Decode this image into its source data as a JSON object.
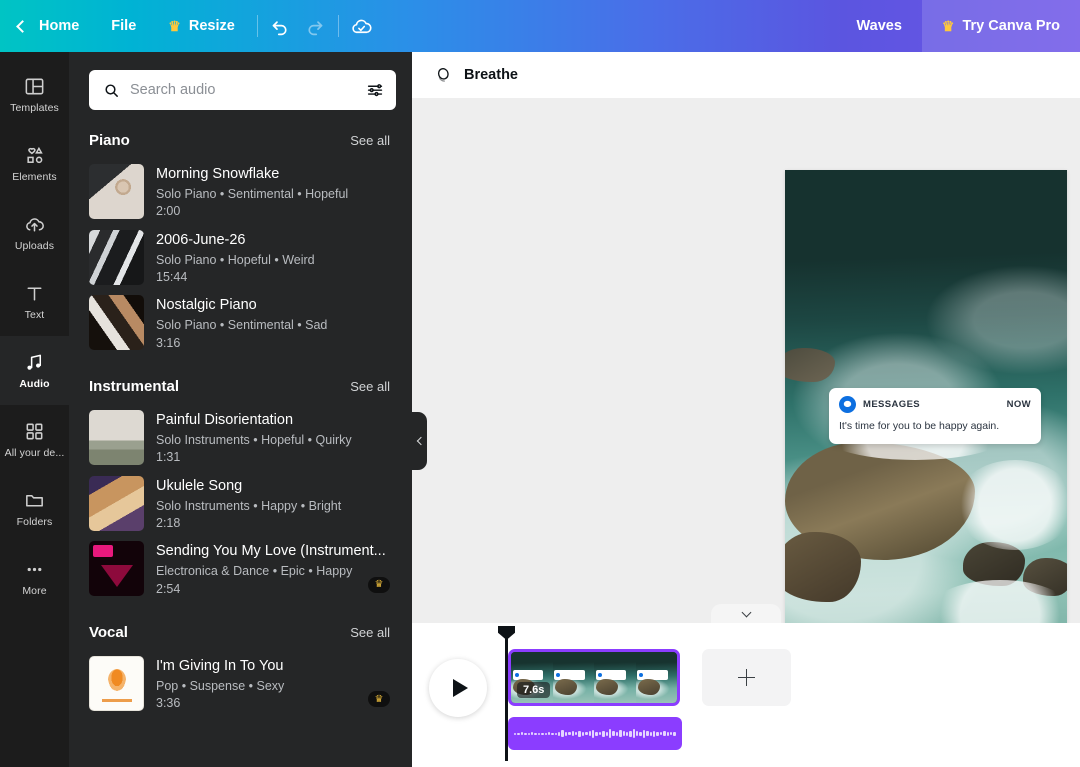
{
  "topbar": {
    "back_icon": "chevron-left-icon",
    "home_label": "Home",
    "file_label": "File",
    "resize_label": "Resize",
    "resize_crown": "♛",
    "undo_icon": "undo-icon",
    "redo_icon": "redo-icon",
    "cloud_icon": "cloud-saved-icon",
    "waves_label": "Waves",
    "try_pro_label": "Try Canva Pro",
    "try_pro_crown": "♛",
    "gradient_start": "#00c4c4",
    "gradient_end": "#6f55e8"
  },
  "rail": {
    "items": [
      {
        "label": "Templates",
        "icon": "templates-icon",
        "active": false
      },
      {
        "label": "Elements",
        "icon": "elements-icon",
        "active": false
      },
      {
        "label": "Uploads",
        "icon": "uploads-icon",
        "active": false
      },
      {
        "label": "Text",
        "icon": "text-icon",
        "active": false
      },
      {
        "label": "Audio",
        "icon": "audio-icon",
        "active": true
      },
      {
        "label": "All your de...",
        "icon": "all-designs-icon",
        "active": false
      },
      {
        "label": "Folders",
        "icon": "folders-icon",
        "active": false
      },
      {
        "label": "More",
        "icon": "more-icon",
        "active": false
      }
    ]
  },
  "panel": {
    "search": {
      "placeholder": "Search audio",
      "value": "",
      "search_icon": "search-icon",
      "filter_icon": "filter-sliders-icon"
    },
    "see_all_label": "See all",
    "pro_badge": "♛",
    "sections": [
      {
        "title": "Piano",
        "tracks": [
          {
            "name": "Morning Snowflake",
            "tags": "Solo Piano • Sentimental • Hopeful",
            "duration": "2:00",
            "art": "art-coffee",
            "pro": false
          },
          {
            "name": "2006-June-26",
            "tags": "Solo Piano • Hopeful • Weird",
            "duration": "15:44",
            "art": "art-piano1",
            "pro": false
          },
          {
            "name": "Nostalgic Piano",
            "tags": "Solo Piano • Sentimental • Sad",
            "duration": "3:16",
            "art": "art-piano2",
            "pro": false
          }
        ]
      },
      {
        "title": "Instrumental",
        "tracks": [
          {
            "name": "Painful Disorientation",
            "tags": "Solo Instruments • Hopeful • Quirky",
            "duration": "1:31",
            "art": "art-scooter",
            "pro": false
          },
          {
            "name": "Ukulele Song",
            "tags": "Solo Instruments • Happy • Bright",
            "duration": "2:18",
            "art": "art-uke",
            "pro": false
          },
          {
            "name": "Sending You My Love (Instrument...",
            "tags": "Electronica & Dance • Epic • Happy",
            "duration": "2:54",
            "art": "art-ld",
            "pro": true
          }
        ]
      },
      {
        "title": "Vocal",
        "tracks": [
          {
            "name": "I'm Giving In To You",
            "tags": "Pop • Suspense • Sexy",
            "duration": "3:36",
            "art": "art-vocal",
            "pro": true
          }
        ]
      }
    ],
    "collapse_icon": "chevron-left-icon"
  },
  "stage": {
    "doc_icon": "design-circle-icon",
    "doc_title": "Breathe",
    "canvas_collapse_icon": "chevron-down-icon",
    "notification": {
      "app_icon": "messages-bubble-icon",
      "app_name": "MESSAGES",
      "time": "NOW",
      "body": "It's time for you to be happy again."
    }
  },
  "timeline": {
    "play_icon": "play-icon",
    "video_clip": {
      "duration_label": "7.6s",
      "selected": true,
      "accent": "#8b3dff"
    },
    "add_clip_icon": "plus-icon",
    "audio_clip": {
      "color": "#8b3dff"
    }
  }
}
